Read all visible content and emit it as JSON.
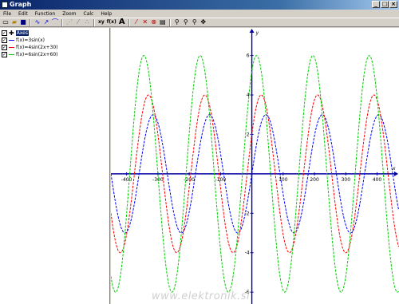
{
  "window": {
    "title": "Graph",
    "controls": [
      "_",
      "□",
      "×"
    ]
  },
  "menu": [
    "File",
    "Edit",
    "Function",
    "Zoom",
    "Calc",
    "Help"
  ],
  "toolbar": {
    "text_buttons": [
      "xy",
      "f(x)",
      "A"
    ]
  },
  "functions": [
    {
      "label": "f(x)=3sin(x)",
      "color": "#0000ff",
      "checked": true
    },
    {
      "label": "f(x)=4sin(2x+30)",
      "color": "#ff0000",
      "checked": true
    },
    {
      "label": "f(x)=6sin(2x+60)",
      "color": "#00cc00",
      "checked": true
    }
  ],
  "tree_root": {
    "label": "Axes",
    "checked": true
  },
  "watermark": "www.elektronik.si",
  "chart_data": {
    "type": "line",
    "x_unit": "degrees",
    "xlim": [
      -450,
      470
    ],
    "ylim": [
      -6.6,
      7.4
    ],
    "x_ticks": [
      -400,
      -300,
      -200,
      -100,
      100,
      200,
      300,
      400
    ],
    "y_ticks": [
      -6,
      -4,
      -2,
      2,
      4,
      6
    ],
    "xlabel": "x",
    "ylabel": "y",
    "grid": false,
    "series": [
      {
        "name": "f(x)=3sin(x)",
        "color": "#0000ff",
        "amplitude": 3,
        "frequency": 2.0,
        "phase_deg": 0
      },
      {
        "name": "f(x)=4sin(2x+30)",
        "color": "#ff0000",
        "amplitude": 4,
        "frequency": 2.0,
        "phase_deg": 30
      },
      {
        "name": "f(x)=6sin(2x+60)",
        "color": "#00cc00",
        "amplitude": 6,
        "frequency": 2.0,
        "phase_deg": 60
      }
    ]
  }
}
